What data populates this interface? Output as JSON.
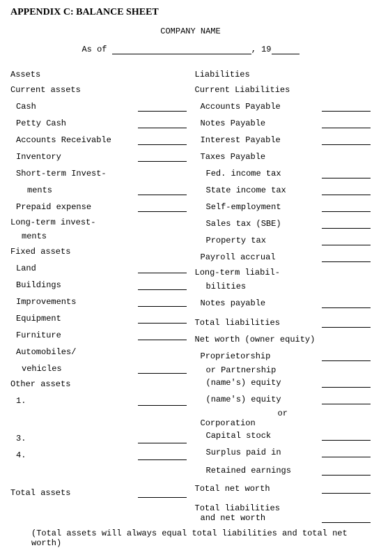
{
  "title": "APPENDIX C: BALANCE SHEET",
  "company": "COMPANY NAME",
  "asof": "As of",
  "comma": ", 19",
  "l": {
    "assets": "Assets",
    "curassets": "Current assets",
    "cash": "Cash",
    "petty": "Petty Cash",
    "ar": "Accounts Receivable",
    "inv": "Inventory",
    "sti1": "Short-term Invest-",
    "sti2": "ments",
    "prepaid": "Prepaid expense",
    "lti1": "Long-term invest-",
    "lti2": "ments",
    "fixed": "Fixed assets",
    "land": "Land",
    "bldg": "Buildings",
    "impr": "Improvements",
    "equip": "Equipment",
    "furn": "Furniture",
    "auto1": "Automobiles/",
    "auto2": "vehicles",
    "other": "Other assets",
    "o1": "1.",
    "o3": "3.",
    "o4": "4.",
    "ta": "Total assets"
  },
  "r": {
    "liab": "Liabilities",
    "curliab": "Current Liabilities",
    "ap": "Accounts Payable",
    "np": "Notes Payable",
    "ip": "Interest Payable",
    "tax": "Taxes Payable",
    "fed": "Fed. income tax",
    "state": "State income tax",
    "self": "Self-employment",
    "sales": "Sales tax (SBE)",
    "prop": "Property tax",
    "pay": "Payroll accrual",
    "ltl1": "Long-term liabil-",
    "ltl2": "bilities",
    "np2": "Notes payable",
    "tl": "Total liabilities",
    "nw": "Net worth (owner equity)",
    "prop1": "Proprietorship",
    "prop2": "or Partnership",
    "ne1": "(name's) equity",
    "ne2": "(name's) equity",
    "or": "or",
    "corp": "Corporation",
    "cs": "Capital stock",
    "sp": "Surplus paid in",
    "re": "Retained earnings",
    "tnw": "Total net worth",
    "tlnw1": "Total liabilities",
    "tlnw2": "and net worth"
  },
  "note": "(Total assets will always equal total liabilities and total net worth)"
}
